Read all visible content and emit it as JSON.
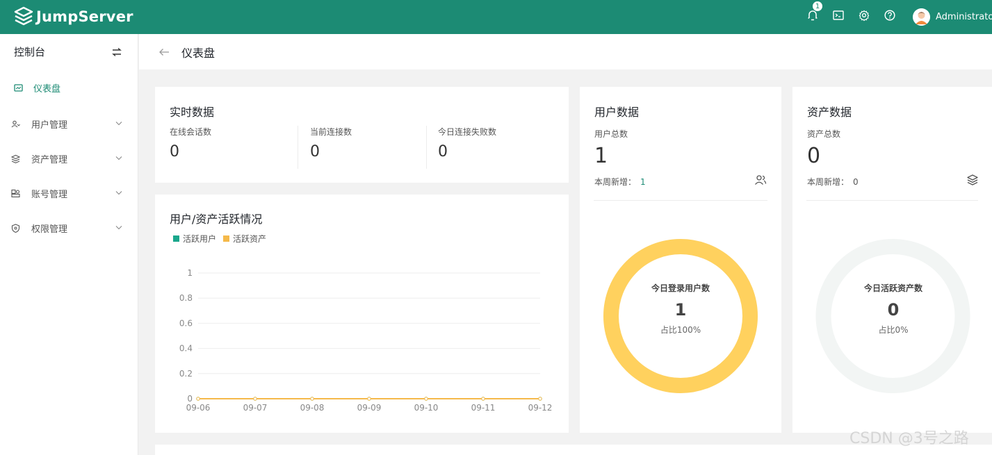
{
  "header": {
    "brand": "JumpServer",
    "notification_count": "1",
    "user_name": "Administrator",
    "icons": [
      "bell-icon",
      "terminal-icon",
      "settings-icon",
      "help-icon"
    ]
  },
  "sidebar": {
    "title": "控制台",
    "items": [
      {
        "label": "仪表盘",
        "icon": "dashboard-icon",
        "active": true
      },
      {
        "label": "用户管理",
        "icon": "users-icon"
      },
      {
        "label": "资产管理",
        "icon": "assets-icon"
      },
      {
        "label": "账号管理",
        "icon": "accounts-icon"
      },
      {
        "label": "权限管理",
        "icon": "permission-icon"
      }
    ]
  },
  "page": {
    "title": "仪表盘"
  },
  "realtime": {
    "title": "实时数据",
    "stats": [
      {
        "label": "在线会话数",
        "value": "0"
      },
      {
        "label": "当前连接数",
        "value": "0"
      },
      {
        "label": "今日连接失败数",
        "value": "0"
      }
    ]
  },
  "activity": {
    "title": "用户/资产活跃情况",
    "legend": [
      {
        "label": "活跃用户",
        "color": "#1aa78c"
      },
      {
        "label": "活跃资产",
        "color": "#f5b94a"
      }
    ]
  },
  "chart_data": {
    "type": "line",
    "x": [
      "09-06",
      "09-07",
      "09-08",
      "09-09",
      "09-10",
      "09-11",
      "09-12"
    ],
    "series": [
      {
        "name": "活跃用户",
        "values": [
          0,
          0,
          0,
          0,
          0,
          0,
          0
        ],
        "color": "#1aa78c"
      },
      {
        "name": "活跃资产",
        "values": [
          0,
          0,
          0,
          0,
          0,
          0,
          0
        ],
        "color": "#f5b94a"
      }
    ],
    "ylim": [
      0,
      1
    ],
    "yticks": [
      "0",
      "0.2",
      "0.4",
      "0.6",
      "0.8",
      "1"
    ],
    "grid": true,
    "legend": "top-left"
  },
  "users": {
    "title": "用户数据",
    "total_label": "用户总数",
    "total": "1",
    "week_label": "本周新增：",
    "week_value": "1",
    "donut_label": "今日登录用户数",
    "donut_value": "1",
    "donut_pct": "占比100%",
    "donut_fraction": 1.0,
    "donut_color": "#ffd15e"
  },
  "assets": {
    "title": "资产数据",
    "total_label": "资产总数",
    "total": "0",
    "week_label": "本周新增：",
    "week_value": "0",
    "donut_label": "今日活跃资产数",
    "donut_value": "0",
    "donut_pct": "占比0%",
    "donut_fraction": 0.0,
    "donut_color": "#ffd15e"
  },
  "watermark": "CSDN @3号之路"
}
